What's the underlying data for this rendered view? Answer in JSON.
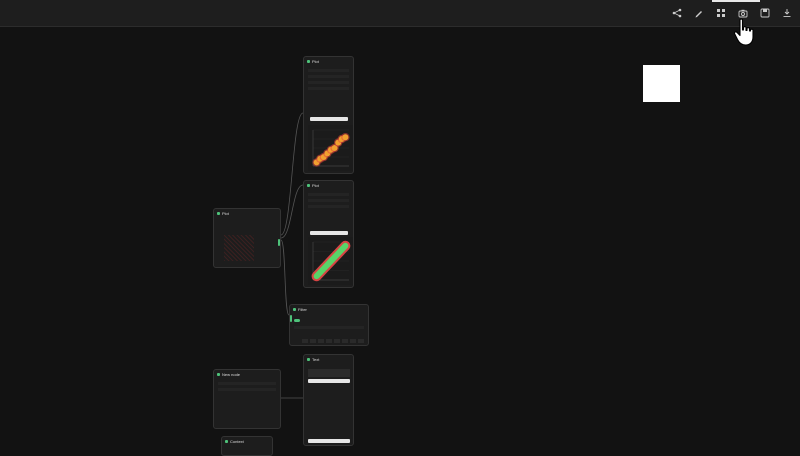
{
  "toolbar": {
    "buttons": [
      {
        "name": "share-icon"
      },
      {
        "name": "edit-icon"
      },
      {
        "name": "grid-icon"
      },
      {
        "name": "camera-icon"
      },
      {
        "name": "save-icon"
      },
      {
        "name": "download-icon"
      }
    ]
  },
  "nodes": {
    "plot_top": {
      "title": "Plot",
      "sub": "",
      "button": "Create"
    },
    "plot_mid": {
      "title": "Plot",
      "sub": "",
      "button": "Create"
    },
    "plot_input": {
      "title": "Plot",
      "sub": "",
      "label": ""
    },
    "filter": {
      "title": "Filter",
      "sub": ""
    },
    "text_bottom": {
      "title": "Text",
      "sub": "",
      "body": "",
      "button": ""
    },
    "new_node": {
      "title": "New node",
      "sub": ""
    },
    "bottom_left": {
      "title": "Context"
    }
  },
  "colors": {
    "accent_green": "#4ec27a",
    "scatter_orange": "#f0a030",
    "scatter_red": "#e0443a",
    "band_green": "#58d468",
    "band_red": "#d84444"
  },
  "chart_data": [
    {
      "type": "scatter",
      "x": [
        1,
        2,
        3,
        4,
        5,
        6,
        7,
        8,
        9
      ],
      "y": [
        1,
        2,
        2.5,
        3.5,
        4.5,
        5,
        6.5,
        7.5,
        8
      ],
      "title": "",
      "xlabel": "",
      "ylabel": ""
    },
    {
      "type": "area",
      "x": [
        1,
        2,
        3,
        4,
        5,
        6,
        7,
        8,
        9
      ],
      "y": [
        1,
        2,
        3,
        4,
        5,
        6,
        7,
        8,
        9
      ],
      "title": "",
      "xlabel": "",
      "ylabel": ""
    }
  ]
}
